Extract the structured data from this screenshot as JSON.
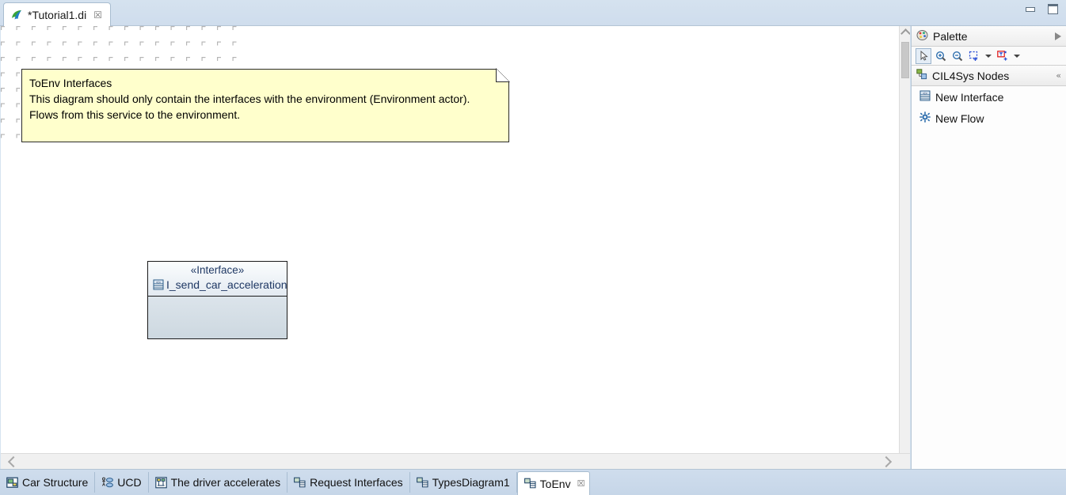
{
  "window": {
    "minimize_label": "Minimize",
    "maximize_label": "Maximize"
  },
  "editor_tab": {
    "title": "*Tutorial1.di",
    "close_glyph": "☒",
    "icon": "papyrus-logo-icon"
  },
  "canvas": {
    "note": {
      "lines": [
        "ToEnv Interfaces",
        "This diagram should only contain the interfaces with the environment (Environment actor).",
        "Flows from this service to the environment."
      ],
      "fill_color": "#ffffcc",
      "border_color": "#2b2b2b"
    },
    "interface_node": {
      "stereotype": "«Interface»",
      "name": "I_send_car_acceleration",
      "icon": "interface-icon",
      "text_color": "#1f3864",
      "header_fill": "#f3f7fa",
      "body_fill": "#d3dce4"
    },
    "vscroll": {
      "up_label": "Scroll up",
      "down_label": "Scroll down"
    },
    "hscroll": {
      "left_label": "Scroll left",
      "right_label": "Scroll right"
    }
  },
  "palette": {
    "title": "Palette",
    "expand_glyph": "▷",
    "header_icon": "palette-icon",
    "toolbar": [
      {
        "name": "select-tool",
        "icon": "arrow-cursor-icon",
        "selected": true
      },
      {
        "name": "zoom-in-tool",
        "icon": "zoom-in-icon",
        "selected": false
      },
      {
        "name": "zoom-out-tool",
        "icon": "zoom-out-icon",
        "selected": false
      },
      {
        "name": "marquee-tool",
        "icon": "marquee-select-icon",
        "selected": false
      },
      {
        "name": "marquee-dropdown",
        "icon": "chevron-down-icon",
        "selected": false
      },
      {
        "name": "pin-tool",
        "icon": "pin-elements-icon",
        "selected": false
      },
      {
        "name": "pin-dropdown",
        "icon": "chevron-down-icon",
        "selected": false
      }
    ],
    "section": {
      "title": "CIL4Sys Nodes",
      "icon": "nodes-icon",
      "collapse_glyph": "«"
    },
    "items": [
      {
        "label": "New Interface",
        "icon": "interface-icon"
      },
      {
        "label": "New Flow",
        "icon": "flow-gear-icon"
      }
    ]
  },
  "bottom_tabs": [
    {
      "label": "Car Structure",
      "icon": "class-diagram-icon",
      "active": false
    },
    {
      "label": "UCD",
      "icon": "usecase-diagram-icon",
      "active": false
    },
    {
      "label": "The driver accelerates",
      "icon": "activity-diagram-icon",
      "active": false
    },
    {
      "label": "Request Interfaces",
      "icon": "component-diagram-icon",
      "active": false
    },
    {
      "label": "TypesDiagram1",
      "icon": "component-diagram-icon",
      "active": false
    },
    {
      "label": "ToEnv",
      "icon": "component-diagram-icon",
      "active": true,
      "close_glyph": "☒"
    }
  ]
}
